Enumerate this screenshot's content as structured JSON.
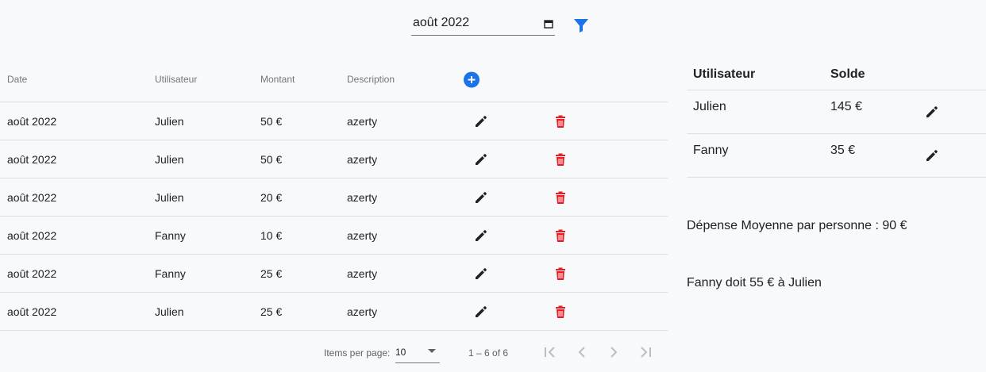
{
  "filter": {
    "month_value": "août 2022",
    "calendar_icon": "calendar-icon",
    "filter_icon": "filter-icon",
    "accent": "#1a73e8"
  },
  "expenses": {
    "headers": {
      "date": "Date",
      "user": "Utilisateur",
      "amount": "Montant",
      "description": "Description"
    },
    "add_icon": "add-circle-icon",
    "rows": [
      {
        "date": "août 2022",
        "user": "Julien",
        "amount": "50 €",
        "description": "azerty"
      },
      {
        "date": "août 2022",
        "user": "Julien",
        "amount": "50 €",
        "description": "azerty"
      },
      {
        "date": "août 2022",
        "user": "Julien",
        "amount": "20 €",
        "description": "azerty"
      },
      {
        "date": "août 2022",
        "user": "Fanny",
        "amount": "10 €",
        "description": "azerty"
      },
      {
        "date": "août 2022",
        "user": "Fanny",
        "amount": "25 €",
        "description": "azerty"
      },
      {
        "date": "août 2022",
        "user": "Julien",
        "amount": "25 €",
        "description": "azerty"
      }
    ],
    "delete_color": "#e51c23"
  },
  "paginator": {
    "items_per_page_label": "Items per page:",
    "page_size": "10",
    "range": "1 – 6 of 6"
  },
  "balances": {
    "headers": {
      "user": "Utilisateur",
      "solde": "Solde"
    },
    "rows": [
      {
        "user": "Julien",
        "solde": "145 €"
      },
      {
        "user": "Fanny",
        "solde": "35 €"
      }
    ]
  },
  "summary": {
    "average": "Dépense Moyenne par personne : 90 €",
    "settlement": "Fanny doit 55 € à Julien"
  }
}
